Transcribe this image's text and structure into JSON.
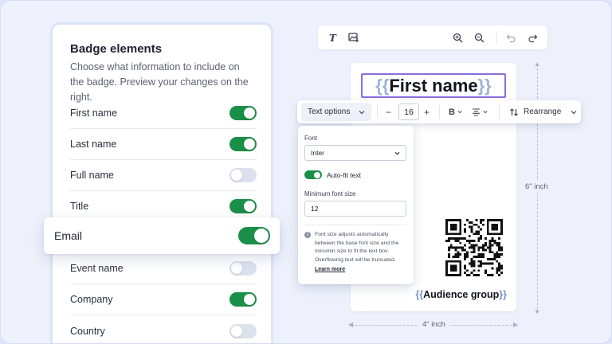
{
  "panel": {
    "title": "Badge elements",
    "description": "Choose what information to include on the badge. Preview your changes on the right.",
    "items": [
      {
        "label": "First name",
        "on": true
      },
      {
        "label": "Last name",
        "on": true
      },
      {
        "label": "Full name",
        "on": false
      },
      {
        "label": "Title",
        "on": true
      },
      {
        "label": "Email",
        "on": true
      },
      {
        "label": "Event name",
        "on": false
      },
      {
        "label": "Company",
        "on": true
      },
      {
        "label": "Country",
        "on": false
      }
    ]
  },
  "toolbar": {
    "icons": [
      "text-icon",
      "add-image-icon",
      "zoom-in-icon",
      "zoom-out-icon",
      "undo-icon",
      "redo-icon"
    ]
  },
  "badge": {
    "open_brace": "{{",
    "close_brace": "}}",
    "name_field": "First name",
    "audience_field": "Audience group",
    "height_label": "6\" inch",
    "width_label": "4\" inch"
  },
  "text_options": {
    "dropdown_label": "Text options",
    "font_size": "16",
    "minus": "−",
    "plus": "+",
    "bold": "B",
    "rearrange_label": "Rearrange"
  },
  "popup": {
    "font_label": "Font",
    "font_value": "Inter",
    "autofit_label": "Auto-fit text",
    "autofit_on": true,
    "min_size_label": "Minimum font size",
    "min_size_value": "12",
    "note": "Font size adjusts automatically between the base font size and the minumin size to fit the text box. Overflowing text will be truncated.",
    "link": "Learn more"
  },
  "colors": {
    "accent_green": "#1a8f47",
    "selection_purple": "#8a6ce0",
    "brace_blue": "#9db3d8"
  }
}
